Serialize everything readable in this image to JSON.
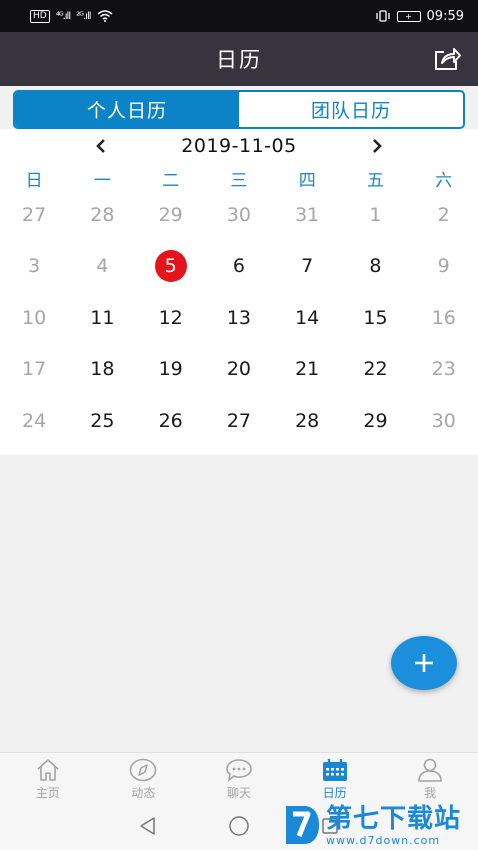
{
  "status_bar": {
    "left_tag": "HD",
    "signal_1": "⁴ᴳ.ıll",
    "signal_2": "²ᴳ.ıll",
    "battery": "+",
    "time": "09:59"
  },
  "header": {
    "title": "日历",
    "share_icon": "share-icon"
  },
  "segments": [
    {
      "label": "个人日历",
      "active": true
    },
    {
      "label": "团队日历",
      "active": false
    }
  ],
  "calendar": {
    "current_date": "2019-11-05",
    "weekdays": [
      "日",
      "一",
      "二",
      "三",
      "四",
      "五",
      "六"
    ],
    "weeks": [
      [
        {
          "d": "27",
          "t": "dim"
        },
        {
          "d": "28",
          "t": "dim"
        },
        {
          "d": "29",
          "t": "dim"
        },
        {
          "d": "30",
          "t": "dim"
        },
        {
          "d": "31",
          "t": "dim"
        },
        {
          "d": "1",
          "t": "dim"
        },
        {
          "d": "2",
          "t": "dim"
        }
      ],
      [
        {
          "d": "3",
          "t": "dim"
        },
        {
          "d": "4",
          "t": "dim"
        },
        {
          "d": "5",
          "t": "today"
        },
        {
          "d": "6",
          "t": "normal"
        },
        {
          "d": "7",
          "t": "normal"
        },
        {
          "d": "8",
          "t": "normal"
        },
        {
          "d": "9",
          "t": "dim"
        }
      ],
      [
        {
          "d": "10",
          "t": "dim"
        },
        {
          "d": "11",
          "t": "normal"
        },
        {
          "d": "12",
          "t": "normal"
        },
        {
          "d": "13",
          "t": "normal"
        },
        {
          "d": "14",
          "t": "normal"
        },
        {
          "d": "15",
          "t": "normal"
        },
        {
          "d": "16",
          "t": "dim"
        }
      ],
      [
        {
          "d": "17",
          "t": "dim"
        },
        {
          "d": "18",
          "t": "normal"
        },
        {
          "d": "19",
          "t": "normal"
        },
        {
          "d": "20",
          "t": "normal"
        },
        {
          "d": "21",
          "t": "normal"
        },
        {
          "d": "22",
          "t": "normal"
        },
        {
          "d": "23",
          "t": "dim"
        }
      ],
      [
        {
          "d": "24",
          "t": "dim"
        },
        {
          "d": "25",
          "t": "normal"
        },
        {
          "d": "26",
          "t": "normal"
        },
        {
          "d": "27",
          "t": "normal"
        },
        {
          "d": "28",
          "t": "normal"
        },
        {
          "d": "29",
          "t": "normal"
        },
        {
          "d": "30",
          "t": "dim"
        }
      ]
    ]
  },
  "fab": {
    "icon": "plus-icon"
  },
  "tabbar": {
    "items": [
      {
        "label": "主页",
        "icon": "home-icon",
        "active": false
      },
      {
        "label": "动态",
        "icon": "compass-icon",
        "active": false
      },
      {
        "label": "聊天",
        "icon": "chat-bubble-icon",
        "active": false
      },
      {
        "label": "日历",
        "icon": "calendar-icon",
        "active": true
      },
      {
        "label": "我",
        "icon": "person-icon",
        "active": false
      }
    ]
  },
  "watermark": {
    "name": "第七下载站",
    "url": "www.d7down.com"
  },
  "colors": {
    "accent": "#0d83c7",
    "header_bg": "#373440",
    "today_red": "#e3151a",
    "fab_blue": "#1b8fdc"
  }
}
